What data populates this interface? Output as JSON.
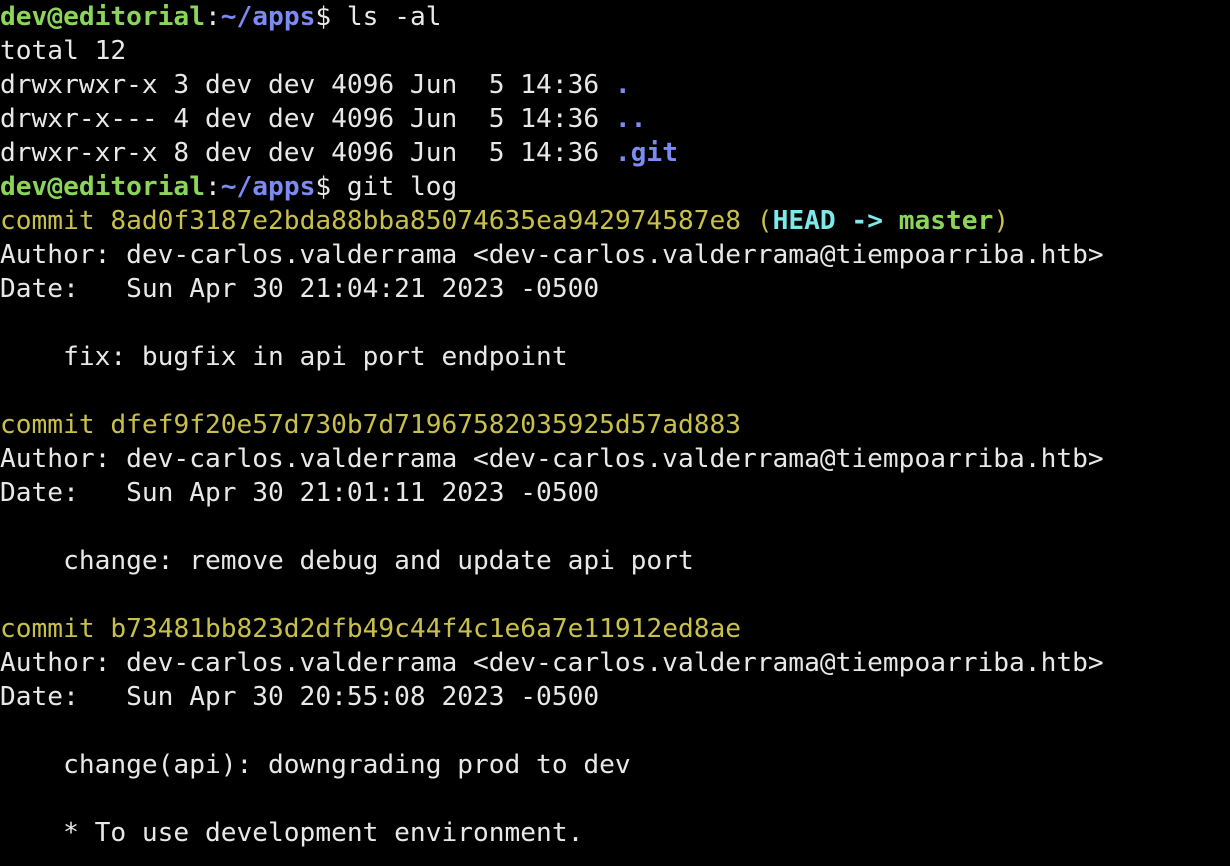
{
  "prompt": {
    "user_host": "dev@editorial",
    "colon": ":",
    "path": "~/apps",
    "dollar": "$ "
  },
  "commands": {
    "ls": "ls -al",
    "git_log": "git log"
  },
  "ls_output": {
    "total": "total 12",
    "entries": [
      {
        "meta": "drwxrwxr-x 3 dev dev 4096 Jun  5 14:36 ",
        "name": "."
      },
      {
        "meta": "drwxr-x--- 4 dev dev 4096 Jun  5 14:36 ",
        "name": ".."
      },
      {
        "meta": "drwxr-xr-x 8 dev dev 4096 Jun  5 14:36 ",
        "name": ".git"
      }
    ]
  },
  "git_log": {
    "commits": [
      {
        "label": "commit ",
        "hash": "8ad0f3187e2bda88bba85074635ea942974587e8",
        "ref_open": " (",
        "head": "HEAD",
        "arrow": " -> ",
        "branch": "master",
        "ref_close": ")",
        "author": "Author: dev-carlos.valderrama <dev-carlos.valderrama@tiempoarriba.htb>",
        "date": "Date:   Sun Apr 30 21:04:21 2023 -0500",
        "message": "    fix: bugfix in api port endpoint"
      },
      {
        "label": "commit ",
        "hash": "dfef9f20e57d730b7d71967582035925d57ad883",
        "author": "Author: dev-carlos.valderrama <dev-carlos.valderrama@tiempoarriba.htb>",
        "date": "Date:   Sun Apr 30 21:01:11 2023 -0500",
        "message": "    change: remove debug and update api port"
      },
      {
        "label": "commit ",
        "hash": "b73481bb823d2dfb49c44f4c1e6a7e11912ed8ae",
        "author": "Author: dev-carlos.valderrama <dev-carlos.valderrama@tiempoarriba.htb>",
        "date": "Date:   Sun Apr 30 20:55:08 2023 -0500",
        "message": "    change(api): downgrading prod to dev",
        "message_extra": "    * To use development environment."
      }
    ]
  },
  "colors": {
    "background": "#000000",
    "foreground": "#e8e8e8",
    "prompt_user": "#8bd65a",
    "prompt_path": "#7b8bf2",
    "commit": "#c8c04a",
    "head": "#7ee9ea",
    "branch": "#8bd65a"
  }
}
